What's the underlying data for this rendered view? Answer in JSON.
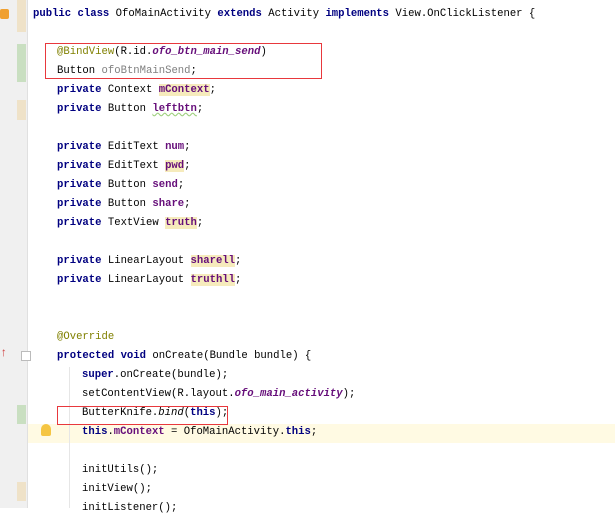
{
  "editor": {
    "lines": [
      {
        "indent": 0,
        "row": 0,
        "seg": [
          [
            "public class ",
            "kw"
          ],
          [
            "OfoMainActivity ",
            ""
          ],
          [
            "extends ",
            "kw"
          ],
          [
            "Activity ",
            ""
          ],
          [
            "implements ",
            "kw"
          ],
          [
            "View.OnClickListener {",
            ""
          ]
        ]
      },
      {
        "indent": 1,
        "row": 2,
        "seg": [
          [
            "@BindView",
            "ann"
          ],
          [
            "(R.id.",
            ""
          ],
          [
            "ofo_btn_main_send",
            "ifld"
          ],
          [
            ")",
            ""
          ]
        ]
      },
      {
        "indent": 1,
        "row": 3,
        "seg": [
          [
            "Button ",
            ""
          ],
          [
            "ofoBtnMainSend",
            "unused"
          ],
          [
            ";",
            ""
          ]
        ]
      },
      {
        "indent": 1,
        "row": 4,
        "seg": [
          [
            "private ",
            "kw"
          ],
          [
            "Context ",
            ""
          ],
          [
            "mContext",
            "fld warn"
          ],
          [
            ";",
            ""
          ]
        ]
      },
      {
        "indent": 1,
        "row": 5,
        "seg": [
          [
            "private ",
            "kw"
          ],
          [
            "Button ",
            ""
          ],
          [
            "leftbtn",
            "fld squig"
          ],
          [
            ";",
            ""
          ]
        ]
      },
      {
        "indent": 1,
        "row": 7,
        "seg": [
          [
            "private ",
            "kw"
          ],
          [
            "EditText ",
            ""
          ],
          [
            "num",
            "fld"
          ],
          [
            ";",
            ""
          ]
        ]
      },
      {
        "indent": 1,
        "row": 8,
        "seg": [
          [
            "private ",
            "kw"
          ],
          [
            "EditText ",
            ""
          ],
          [
            "pwd",
            "fld warn"
          ],
          [
            ";",
            ""
          ]
        ]
      },
      {
        "indent": 1,
        "row": 9,
        "seg": [
          [
            "private ",
            "kw"
          ],
          [
            "Button ",
            ""
          ],
          [
            "send",
            "fld"
          ],
          [
            ";",
            ""
          ]
        ]
      },
      {
        "indent": 1,
        "row": 10,
        "seg": [
          [
            "private ",
            "kw"
          ],
          [
            "Button ",
            ""
          ],
          [
            "share",
            "fld"
          ],
          [
            ";",
            ""
          ]
        ]
      },
      {
        "indent": 1,
        "row": 11,
        "seg": [
          [
            "private ",
            "kw"
          ],
          [
            "TextView ",
            ""
          ],
          [
            "truth",
            "fld warn"
          ],
          [
            ";",
            ""
          ]
        ]
      },
      {
        "indent": 1,
        "row": 13,
        "seg": [
          [
            "private ",
            "kw"
          ],
          [
            "LinearLayout ",
            ""
          ],
          [
            "sharell",
            "fld warn"
          ],
          [
            ";",
            ""
          ]
        ]
      },
      {
        "indent": 1,
        "row": 14,
        "seg": [
          [
            "private ",
            "kw"
          ],
          [
            "LinearLayout ",
            ""
          ],
          [
            "truthll",
            "fld warn"
          ],
          [
            ";",
            ""
          ]
        ]
      },
      {
        "indent": 1,
        "row": 17,
        "seg": [
          [
            "@Override",
            "ann"
          ]
        ]
      },
      {
        "indent": 1,
        "row": 18,
        "seg": [
          [
            "protected void ",
            "kw"
          ],
          [
            "onCreate(Bundle bundle) {",
            ""
          ]
        ]
      },
      {
        "indent": 2,
        "row": 19,
        "seg": [
          [
            "super",
            "kw"
          ],
          [
            ".onCreate(bundle);",
            ""
          ]
        ]
      },
      {
        "indent": 2,
        "row": 20,
        "seg": [
          [
            "setContentView(R.layout.",
            ""
          ],
          [
            "ofo_main_activity",
            "ifld"
          ],
          [
            ");",
            ""
          ]
        ]
      },
      {
        "indent": 2,
        "row": 21,
        "seg": [
          [
            "ButterKnife.",
            ""
          ],
          [
            "bind",
            "it"
          ],
          [
            "(",
            ""
          ],
          [
            "this",
            "kw"
          ],
          [
            ");",
            ""
          ]
        ]
      },
      {
        "indent": 2,
        "row": 22,
        "seg": [
          [
            "this",
            "kw"
          ],
          [
            ".",
            ""
          ],
          [
            "mContext",
            "fld"
          ],
          [
            " = OfoMainActivity.",
            ""
          ],
          [
            "this",
            "kw"
          ],
          [
            ";",
            ""
          ]
        ]
      },
      {
        "indent": 2,
        "row": 24,
        "seg": [
          [
            "initUtils();",
            ""
          ]
        ]
      },
      {
        "indent": 2,
        "row": 25,
        "seg": [
          [
            "initView();",
            ""
          ]
        ]
      },
      {
        "indent": 2,
        "row": 26,
        "seg": [
          [
            "initListener();",
            ""
          ]
        ]
      }
    ]
  }
}
